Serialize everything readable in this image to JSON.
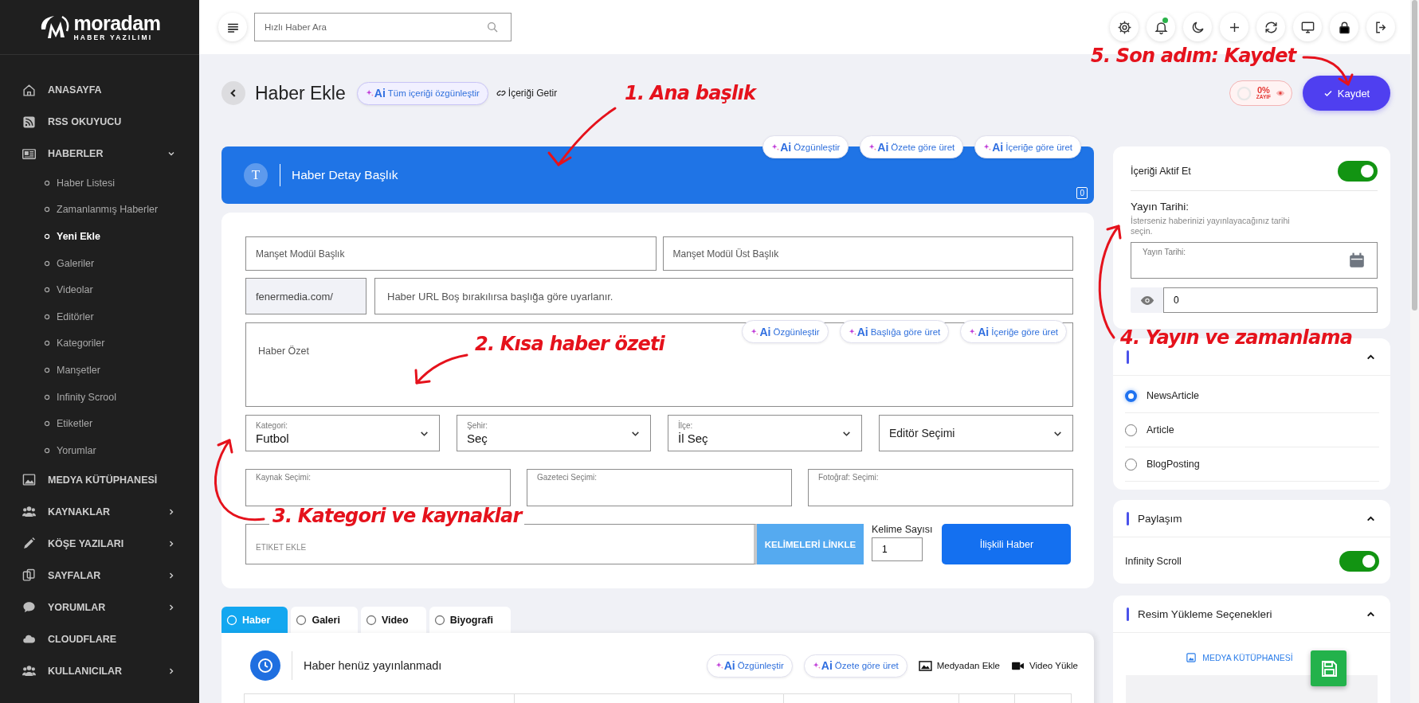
{
  "sidebar": {
    "logo": {
      "name": "moradam",
      "tagline": "HABER YAZILIMI"
    },
    "items": [
      {
        "label": "ANASAYFA"
      },
      {
        "label": "RSS OKUYUCU"
      },
      {
        "label": "HABERLER",
        "expanded": true,
        "children": [
          {
            "label": "Haber Listesi",
            "selected": false
          },
          {
            "label": "Zamanlanmış Haberler",
            "selected": false
          },
          {
            "label": "Yeni Ekle",
            "selected": true
          },
          {
            "label": "Galeriler",
            "selected": false
          },
          {
            "label": "Videolar",
            "selected": false
          },
          {
            "label": "Editörler",
            "selected": false
          },
          {
            "label": "Kategoriler",
            "selected": false
          },
          {
            "label": "Manşetler",
            "selected": false
          },
          {
            "label": "Infinity Scrool",
            "selected": false
          },
          {
            "label": "Etiketler",
            "selected": false
          },
          {
            "label": "Yorumlar",
            "selected": false
          }
        ]
      },
      {
        "label": "MEDYA KÜTÜPHANESİ"
      },
      {
        "label": "KAYNAKLAR",
        "expanded": false
      },
      {
        "label": "KÖŞE YAZILARI",
        "expanded": false
      },
      {
        "label": "SAYFALAR",
        "expanded": false
      },
      {
        "label": "YORUMLAR",
        "expanded": false
      },
      {
        "label": "CLOUDFLARE"
      },
      {
        "label": "KULLANICILAR",
        "expanded": false
      }
    ]
  },
  "topbar": {
    "search": {
      "placeholder": "Hızlı Haber Ara"
    },
    "notification_dot": true
  },
  "header": {
    "title": "Haber Ekle",
    "ai_button": {
      "badge": "Ai",
      "label": "Tüm içeriği özgünleştir"
    },
    "link": "İçeriği Getir",
    "score": {
      "value": "0%",
      "label": "ZAYIF"
    },
    "save_button": "Kaydet"
  },
  "title_bar": {
    "icon_letter": "T",
    "placeholder": "Haber Detay Başlık",
    "counter": "0",
    "ai_buttons": [
      {
        "badge": "Ai",
        "label": "Özgünleştir"
      },
      {
        "badge": "Ai",
        "label": "Özete göre üret"
      },
      {
        "badge": "Ai",
        "label": "İçeriğe göre üret"
      }
    ]
  },
  "form": {
    "headline_fields": [
      {
        "placeholder": "Manşet Modül Başlık"
      },
      {
        "placeholder": "Manşet Modül Üst Başlık"
      }
    ],
    "url": {
      "prefix": "fenermedia.com/",
      "placeholder": "Haber URL Boş bırakılırsa başlığa göre uyarlanır."
    },
    "summary": {
      "placeholder": "Haber Özet",
      "ai_buttons": [
        {
          "badge": "Ai",
          "label": "Özgünleştir"
        },
        {
          "badge": "Ai",
          "label": "Başlığa göre üret"
        },
        {
          "badge": "Ai",
          "label": "İçeriğe göre üret"
        }
      ]
    },
    "selects": [
      {
        "label": "Kategori:",
        "value": "Futbol"
      },
      {
        "label": "Şehir:",
        "value": "Seç"
      },
      {
        "label": "İlçe:",
        "value": "İl Seç"
      },
      {
        "placeholder": "Editör Seçimi"
      }
    ],
    "pickers": [
      {
        "label": "Kaynak Seçimi:"
      },
      {
        "label": "Gazeteci Seçimi:"
      },
      {
        "label": "Fotoğraf: Seçimi:"
      }
    ],
    "tags": {
      "placeholder": "ETİKET EKLE",
      "link_button": "KELİMELERİ LİNKLE",
      "word_count": {
        "label": "Kelime Sayısı",
        "value": "1"
      },
      "related_button": "İlişkili Haber"
    }
  },
  "content_tabs": [
    {
      "label": "Haber",
      "selected": true
    },
    {
      "label": "Galeri",
      "selected": false
    },
    {
      "label": "Video",
      "selected": false
    },
    {
      "label": "Biyografi",
      "selected": false
    }
  ],
  "content_panel": {
    "status": "Haber henüz yayınlanmadı",
    "ai_buttons": [
      {
        "badge": "Ai",
        "label": "Özgünleştir"
      },
      {
        "badge": "Ai",
        "label": "Özete göre üret"
      }
    ],
    "actions": [
      "Medyadan Ekle",
      "Video Yükle"
    ]
  },
  "side": {
    "publish_card": {
      "active_toggle": {
        "label": "İçeriği Aktif Et",
        "on": true
      },
      "date_heading": "Yayın Tarihi:",
      "date_hint": "İsterseniz haberinizi yayınlayacağınız tarihi seçin.",
      "date_field": {
        "label": "Yayın Tarihi:"
      },
      "views_field": {
        "value": "0"
      }
    },
    "schema_card": {
      "expanded": true,
      "options": [
        {
          "label": "NewsArticle",
          "selected": true
        },
        {
          "label": "Article",
          "selected": false
        },
        {
          "label": "BlogPosting",
          "selected": false
        }
      ]
    },
    "share_card": {
      "title": "Paylaşım",
      "expanded": true,
      "toggle": {
        "label": "Infinity Scroll",
        "on": true
      }
    },
    "image_card": {
      "title": "Resim Yükleme Seçenekleri",
      "expanded": true,
      "media_link": "MEDYA KÜTÜPHANESİ"
    }
  },
  "annotations": [
    {
      "text": "5. Son adım: Kaydet"
    },
    {
      "text": "1. Ana başlık"
    },
    {
      "text": "2. Kısa haber özeti"
    },
    {
      "text": "4. Yayın ve zamanlama"
    },
    {
      "text": "3. Kategori ve kaynaklar"
    }
  ]
}
